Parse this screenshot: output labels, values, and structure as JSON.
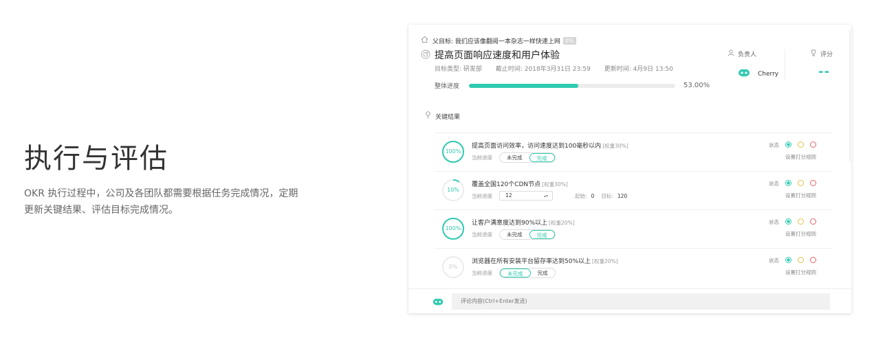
{
  "hero": {
    "title": "执行与评估",
    "description": "OKR 执行过程中，公司及各团队都需要根据任务完成情况，定期更新关键结果、评估目标完成情况。"
  },
  "objective": {
    "parent_label": "父目标: 我们应该像翻阅一本杂志一样快速上网",
    "parent_progress": "0%",
    "title": "提高页面响应速度和用户体验",
    "type": "目标类型:  研发部",
    "deadline": "截止时间:  2018年3月31日 23:59",
    "updated": "更新时间:  4月9日 13:50",
    "progress_label": "整体进度",
    "progress_value": 53.0,
    "progress_text": "53.00%",
    "owner_label": "负责人",
    "owner_name": "Cherry",
    "score_label": "评分",
    "score_value": "--"
  },
  "key_results": {
    "header": "关键结果",
    "status_label": "状态",
    "rule_link": "设置打分规则",
    "progress_caption": "当前进度",
    "incomplete_label": "未完成",
    "complete_label": "完成",
    "items": [
      {
        "title": "提高页面访问效率，访问速度达到100毫秒以内",
        "weight": "[权重30%]",
        "pct": "100%",
        "fraction": 1.0,
        "mode": "toggle",
        "done": true
      },
      {
        "title": "覆盖全国120个CDN节点",
        "weight": "[权重30%]",
        "pct": "10%",
        "fraction": 0.1,
        "mode": "number",
        "current": "12",
        "start_label": "起始:",
        "start": "0",
        "target_label": "目标:",
        "target": "120"
      },
      {
        "title": "让客户满意度达到90%以上",
        "weight": "[权重20%]",
        "pct": "100%",
        "fraction": 1.0,
        "mode": "toggle",
        "done": true
      },
      {
        "title": "浏览器在所有安装平台留存率达到50%以上",
        "weight": "[权重20%]",
        "pct": "0%",
        "fraction": 0.0,
        "mode": "toggle",
        "done": false
      }
    ]
  },
  "comment": {
    "placeholder": "评论内容(Ctrl+Enter发送)"
  },
  "colors": {
    "accent": "#2fcab0",
    "yellow": "#e6c045",
    "red": "#e06262"
  }
}
